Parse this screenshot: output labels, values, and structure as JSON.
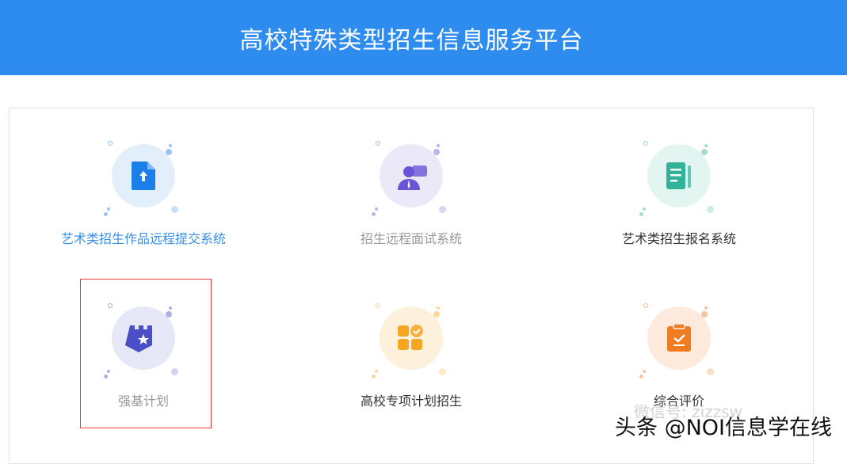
{
  "header": {
    "title": "高校特殊类型招生信息服务平台"
  },
  "items": [
    {
      "label": "艺术类招生作品远程提交系统",
      "icon": "file-upload-icon",
      "color": "#1a7fe8",
      "bg": "#e3eefb",
      "label_color": "#3a8ee6"
    },
    {
      "label": "招生远程面试系统",
      "icon": "interview-person-icon",
      "color": "#6b55d6",
      "bg": "#ebe8f8",
      "label_color": "#999999"
    },
    {
      "label": "艺术类招生报名系统",
      "icon": "registration-form-icon",
      "color": "#30b39a",
      "bg": "#e3f5f0",
      "label_color": "#333333"
    },
    {
      "label": "强基计划",
      "icon": "castle-shield-star-icon",
      "color": "#4b4fc6",
      "bg": "#e6e7f7",
      "label_color": "#999999"
    },
    {
      "label": "高校专项计划招生",
      "icon": "apps-check-icon",
      "color": "#f5a623",
      "bg": "#fdf1dc",
      "label_color": "#333333"
    },
    {
      "label": "综合评价",
      "icon": "clipboard-check-icon",
      "color": "#f07c22",
      "bg": "#fdeadd",
      "label_color": "#333333"
    }
  ],
  "watermark": {
    "wechat": "微信号: zizzsw",
    "toutiao": "头条 @NOI信息学在线"
  }
}
